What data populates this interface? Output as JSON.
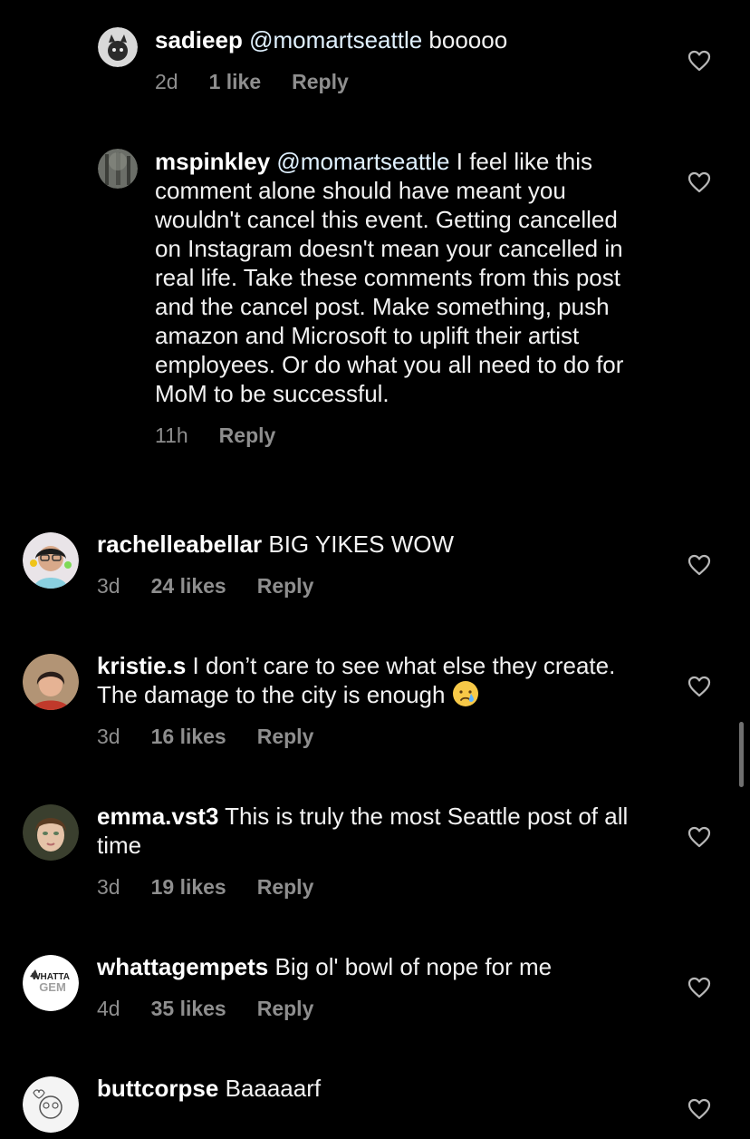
{
  "comments": [
    {
      "username": "sadieep",
      "mention": "@momartseattle",
      "text": " booooo",
      "time": "2d",
      "likes": "1 like",
      "reply": "Reply",
      "avatar_icon": "cat-avatar"
    },
    {
      "username": "mspinkley",
      "mention": "@momartseattle",
      "text": " I feel like this comment alone should have meant you wouldn't cancel this event. Getting cancelled on Instagram doesn't mean your cancelled in real life. Take these comments from this post and the cancel post. Make something, push amazon and Microsoft to uplift their artist employees. Or do what you all need to do for MoM to be successful.",
      "time": "11h",
      "likes": "",
      "reply": "Reply",
      "avatar_icon": "forest-avatar"
    },
    {
      "username": "rachelleabellar",
      "text": " BIG YIKES WOW",
      "time": "3d",
      "likes": "24 likes",
      "reply": "Reply",
      "avatar_icon": "person-avatar"
    },
    {
      "username": "kristie.s",
      "text": " I don’t care to see what else they create. The damage to the city is enough ",
      "emoji": "crying-face-emoji",
      "time": "3d",
      "likes": "16 likes",
      "reply": "Reply",
      "avatar_icon": "person-avatar"
    },
    {
      "username": "emma.vst3",
      "text": " This is truly the most Seattle post of all time",
      "time": "3d",
      "likes": "19 likes",
      "reply": "Reply",
      "avatar_icon": "person-avatar"
    },
    {
      "username": "whattagempets",
      "text": " Big ol' bowl of nope for me",
      "time": "4d",
      "likes": "35 likes",
      "reply": "Reply",
      "avatar_icon": "logo-avatar",
      "avatar_text": [
        "WHATTA",
        "GEM"
      ]
    },
    {
      "username": "buttcorpse",
      "text": " Baaaaarf",
      "time": "",
      "likes": "",
      "reply": "",
      "avatar_icon": "doodle-avatar"
    }
  ],
  "icons": {
    "like": "heart-outline-icon"
  },
  "colors": {
    "background": "#000000",
    "meta": "#8e8e8e",
    "mention": "#e0f1ff"
  }
}
